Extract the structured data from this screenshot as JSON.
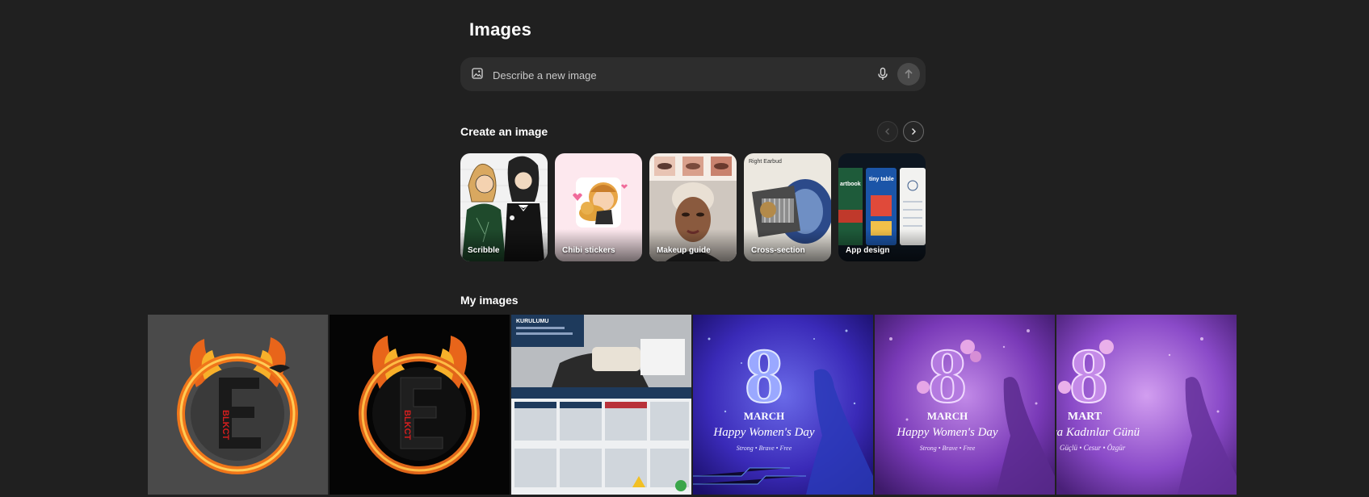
{
  "header": {
    "title": "Images"
  },
  "prompt": {
    "placeholder": "Describe a new image"
  },
  "create_section": {
    "title": "Create an image",
    "cards": [
      {
        "label": "Scribble"
      },
      {
        "label": "Chibi stickers"
      },
      {
        "label": "Makeup guide"
      },
      {
        "label": "Cross-section",
        "art_text": "Right Earbud"
      },
      {
        "label": "App design",
        "art_texts": [
          "artbook",
          "tiny table"
        ]
      }
    ]
  },
  "my_images": {
    "title": "My images",
    "items": [
      {
        "art_text": "BLKCT"
      },
      {
        "art_text": "BLKCT"
      },
      {
        "art_text": "KURULUMU"
      },
      {
        "art_texts": [
          "8",
          "MARCH",
          "Happy Women's Day",
          "Strong • Brave • Free"
        ]
      },
      {
        "art_texts": [
          "8",
          "MARCH",
          "Happy Women's Day",
          "Strong • Brave • Free"
        ]
      },
      {
        "art_texts": [
          "8",
          "MART",
          "ya Kadınlar Günü",
          "Güçlü • Cesur • Özgür"
        ]
      }
    ]
  },
  "colors": {
    "background": "#202020",
    "prompt_bar": "#2d2d2d",
    "text": "#ffffff"
  },
  "icons": {
    "prompt": "image-icon",
    "mic": "microphone-icon",
    "send": "arrow-up-icon",
    "prev": "chevron-left-icon",
    "next": "chevron-right-icon"
  }
}
